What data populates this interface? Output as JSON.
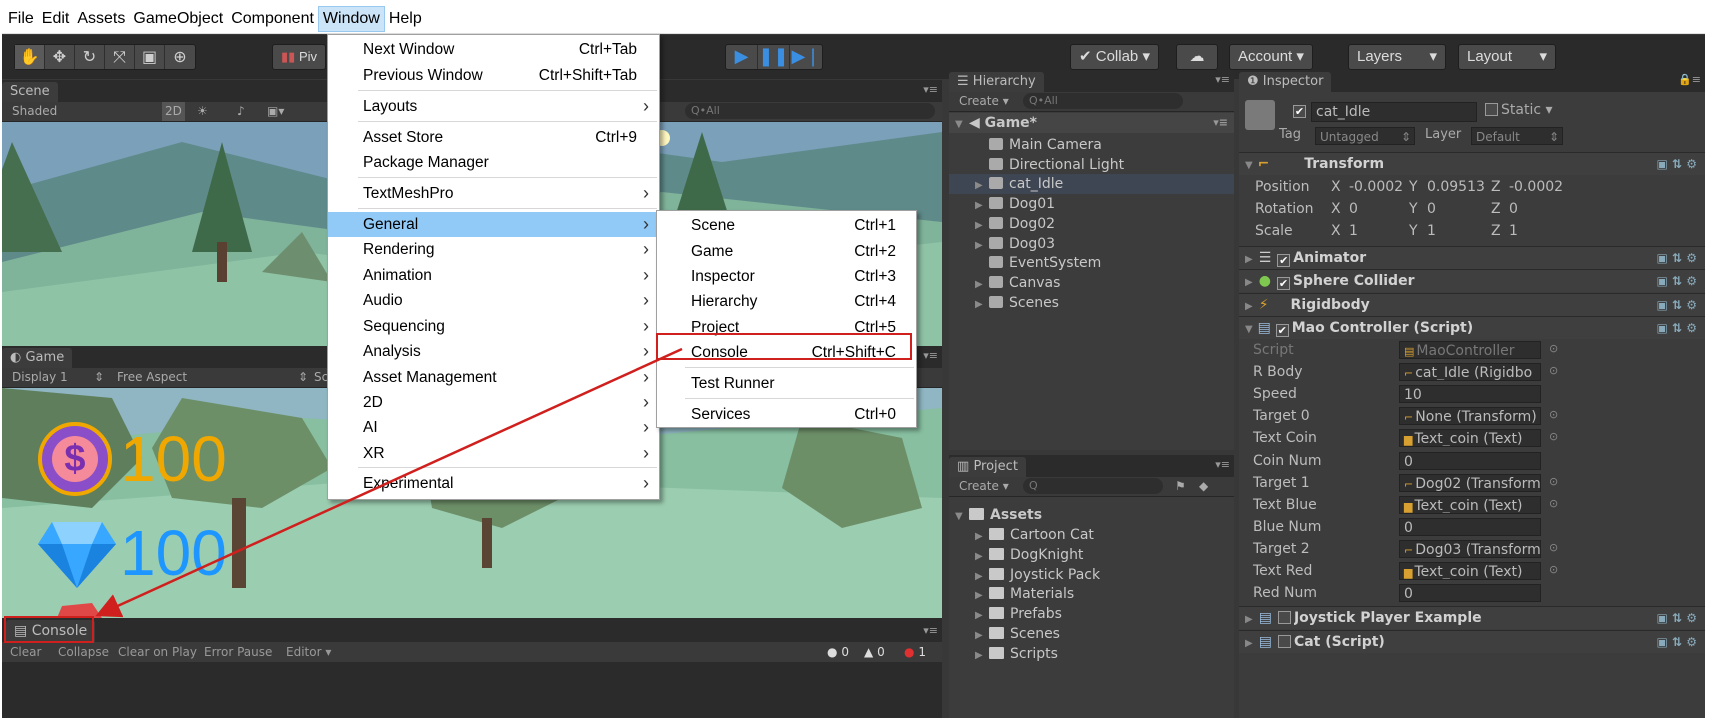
{
  "menubar": {
    "items": [
      "File",
      "Edit",
      "Assets",
      "GameObject",
      "Component",
      "Window",
      "Help"
    ],
    "active": "Window"
  },
  "toolbar": {
    "transform_tools": [
      "hand-tool",
      "move-tool",
      "rotate-tool",
      "scale-tool",
      "rect-tool",
      "transform-tool"
    ],
    "pivot_label": "Piv",
    "play_controls": [
      "play-icon",
      "pause-icon",
      "step-icon"
    ],
    "collab_label": "Collab",
    "account_label": "Account",
    "layers_label": "Layers",
    "layout_label": "Layout"
  },
  "scene": {
    "tab": "Scene",
    "shading": "Shaded",
    "mode_2d": "2D",
    "search_placeholder": "Q•All"
  },
  "game": {
    "tab": "Game",
    "display": "Display 1",
    "aspect": "Free Aspect",
    "scale_label": "Sc",
    "coin_value": "100",
    "gem_value": "100"
  },
  "console": {
    "tab": "Console",
    "buttons": [
      "Clear",
      "Collapse",
      "Clear on Play",
      "Error Pause",
      "Editor"
    ],
    "counts": {
      "info": "0",
      "warn": "0",
      "error": "1"
    }
  },
  "window_menu": {
    "items": [
      {
        "label": "Next Window",
        "shortcut": "Ctrl+Tab"
      },
      {
        "label": "Previous Window",
        "shortcut": "Ctrl+Shift+Tab"
      },
      {
        "label": "Layouts",
        "submenu": true
      },
      {
        "label": "Asset Store",
        "shortcut": "Ctrl+9"
      },
      {
        "label": "Package Manager"
      },
      {
        "label": "TextMeshPro",
        "submenu": true
      },
      {
        "label": "General",
        "submenu": true,
        "highlighted": true
      },
      {
        "label": "Rendering",
        "submenu": true
      },
      {
        "label": "Animation",
        "submenu": true
      },
      {
        "label": "Audio",
        "submenu": true
      },
      {
        "label": "Sequencing",
        "submenu": true
      },
      {
        "label": "Analysis",
        "submenu": true
      },
      {
        "label": "Asset Management",
        "submenu": true
      },
      {
        "label": "2D",
        "submenu": true
      },
      {
        "label": "AI",
        "submenu": true
      },
      {
        "label": "XR",
        "submenu": true
      },
      {
        "label": "Experimental",
        "submenu": true
      }
    ]
  },
  "general_menu": {
    "items": [
      {
        "label": "Scene",
        "shortcut": "Ctrl+1"
      },
      {
        "label": "Game",
        "shortcut": "Ctrl+2"
      },
      {
        "label": "Inspector",
        "shortcut": "Ctrl+3"
      },
      {
        "label": "Hierarchy",
        "shortcut": "Ctrl+4"
      },
      {
        "label": "Project",
        "shortcut": "Ctrl+5"
      },
      {
        "label": "Console",
        "shortcut": "Ctrl+Shift+C"
      },
      {
        "label": "Test Runner"
      },
      {
        "label": "Services",
        "shortcut": "Ctrl+0"
      }
    ]
  },
  "hierarchy": {
    "tab": "Hierarchy",
    "create": "Create",
    "search_placeholder": "Q•All",
    "scene_name": "Game*",
    "items": [
      {
        "label": "Main Camera",
        "expandable": false
      },
      {
        "label": "Directional Light",
        "expandable": false
      },
      {
        "label": "cat_Idle",
        "expandable": true,
        "selected": true
      },
      {
        "label": "Dog01",
        "expandable": true
      },
      {
        "label": "Dog02",
        "expandable": true
      },
      {
        "label": "Dog03",
        "expandable": true
      },
      {
        "label": "EventSystem",
        "expandable": false
      },
      {
        "label": "Canvas",
        "expandable": true
      },
      {
        "label": "Scenes",
        "expandable": true
      }
    ]
  },
  "project": {
    "tab": "Project",
    "create": "Create",
    "root": "Assets",
    "folders": [
      "Cartoon Cat",
      "DogKnight",
      "Joystick Pack",
      "Materials",
      "Prefabs",
      "Scenes",
      "Scripts"
    ]
  },
  "inspector": {
    "tab": "Inspector",
    "object_name": "cat_Idle",
    "static_label": "Static",
    "tag_label": "Tag",
    "tag_value": "Untagged",
    "layer_label": "Layer",
    "layer_value": "Default",
    "transform": {
      "title": "Transform",
      "rows": [
        {
          "label": "Position",
          "x": "-0.0002",
          "y": "0.09513",
          "z": "-0.0002"
        },
        {
          "label": "Rotation",
          "x": "0",
          "y": "0",
          "z": "0"
        },
        {
          "label": "Scale",
          "x": "1",
          "y": "1",
          "z": "1"
        }
      ]
    },
    "components": [
      "Animator",
      "Sphere Collider",
      "Rigidbody"
    ],
    "mao_controller": {
      "title": "Mao Controller (Script)",
      "fields": [
        {
          "label": "Script",
          "value": "MaoController"
        },
        {
          "label": "R Body",
          "value": "cat_Idle (Rigidbo"
        },
        {
          "label": "Speed",
          "value": "10"
        },
        {
          "label": "Target 0",
          "value": "None (Transform)"
        },
        {
          "label": "Text Coin",
          "value": "Text_coin (Text)"
        },
        {
          "label": "Coin Num",
          "value": "0"
        },
        {
          "label": "Target 1",
          "value": "Dog02 (Transform"
        },
        {
          "label": "Text Blue",
          "value": "Text_coin (Text)"
        },
        {
          "label": "Blue Num",
          "value": "0"
        },
        {
          "label": "Target 2",
          "value": "Dog03 (Transform"
        },
        {
          "label": "Text Red",
          "value": "Text_coin (Text)"
        },
        {
          "label": "Red Num",
          "value": "0"
        }
      ]
    },
    "more_components": [
      "Joystick Player Example",
      "Cat (Script)"
    ]
  },
  "colors": {
    "highlight_blue": "#91c9f7",
    "annotation_red": "#d0201e",
    "coin_orange": "#f0a800",
    "gem_blue": "#1e96ff"
  }
}
